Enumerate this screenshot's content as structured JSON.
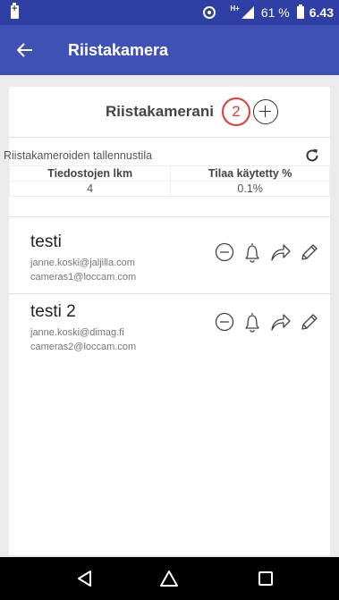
{
  "status_bar": {
    "network": "H+",
    "battery_percent": "61 %",
    "time": "6.43"
  },
  "app_bar": {
    "title": "Riistakamera"
  },
  "cameras_card": {
    "title": "Riistakamerani",
    "count": "2"
  },
  "storage": {
    "label": "Riistakameroiden tallennustila",
    "headers": [
      "Tiedostojen lkm",
      "Tilaa käytetty %"
    ],
    "values": [
      "4",
      "0.1%"
    ]
  },
  "cameras": [
    {
      "name": "testi",
      "email": "janne.koski@jaljilla.com",
      "server": "cameras1@loccam.com"
    },
    {
      "name": "testi 2",
      "email": "janne.koski@dimag.fi",
      "server": "cameras2@loccam.com"
    }
  ],
  "icons": {
    "back": "arrow-left",
    "add": "plus-circle",
    "refresh": "refresh",
    "remove": "minus-circle",
    "alarm": "bell",
    "share": "share-arrow",
    "edit": "pencil",
    "nav_back": "triangle-left",
    "nav_home": "circle",
    "nav_recent": "square"
  },
  "colors": {
    "status_bar": "#2f3fa3",
    "app_bar": "#3f51b5",
    "badge": "#e53935",
    "background": "#ebebeb"
  }
}
